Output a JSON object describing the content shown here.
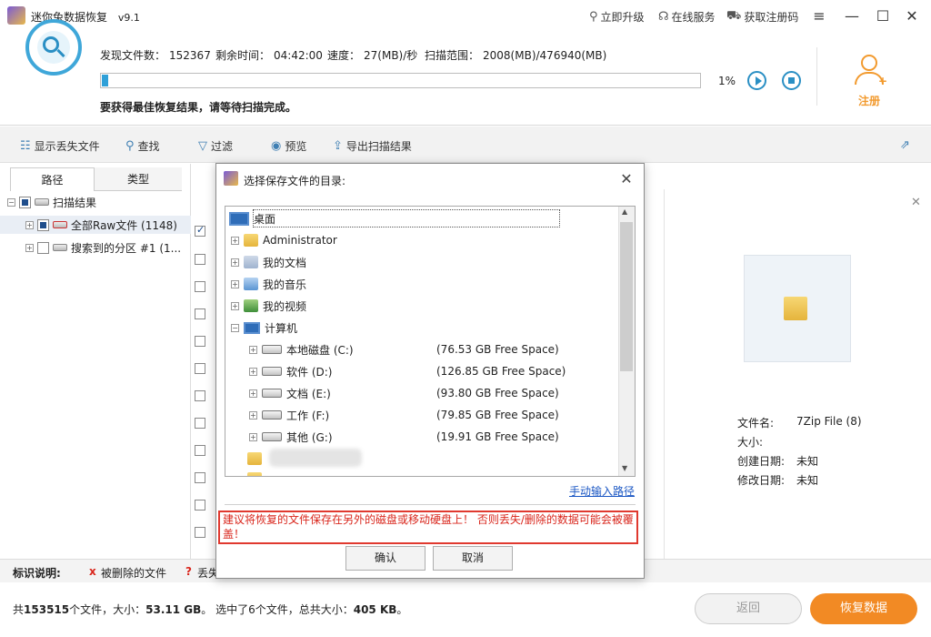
{
  "titlebar": {
    "app_title": "迷你兔数据恢复",
    "version": "v9.1",
    "links": [
      "立即升级",
      "在线服务",
      "获取注册码"
    ]
  },
  "scan": {
    "found_label": "发现文件数：",
    "found_value": "152367",
    "remaining_label": "剩余时间：",
    "remaining_value": "04:42:00",
    "speed_label": "速度：",
    "speed_value": "27(MB)/秒",
    "range_label": "扫描范围：",
    "range_value": "2008(MB)/476940(MB)",
    "progress_percent": "1%",
    "progress_fraction": 0.01,
    "hint": "要获得最佳恢复结果，请等待扫描完成。"
  },
  "register_label": "注册",
  "toolbar": {
    "show_lost": "显示丢失文件",
    "find": "查找",
    "filter": "过滤",
    "preview": "预览",
    "export": "导出扫描结果"
  },
  "left_panel": {
    "tab_path": "路径",
    "tab_type": "类型",
    "tree": [
      "扫描结果",
      "全部Raw文件 (1148)",
      "搜索到的分区 #1 (1..."
    ]
  },
  "preview": {
    "filename_label": "文件名:",
    "filename_value": "7Zip File (8)",
    "size_label": "大小:",
    "size_value": "",
    "created_label": "创建日期:",
    "created_value": "未知",
    "modified_label": "修改日期:",
    "modified_value": "未知"
  },
  "legend": {
    "title": "标识说明:",
    "deleted_mark": "x",
    "deleted": "被删除的文件",
    "lost_mark": "?",
    "lost": "丢失"
  },
  "summary": {
    "prefix": "共",
    "count": "153515",
    "mid": "个文件，大小：",
    "size": "53.11 GB",
    "selected": "。 选中了6个文件，总共大小：",
    "sel_size": "405 KB",
    "suffix": "。"
  },
  "buttons": {
    "back": "返回",
    "recover": "恢复数据"
  },
  "dialog": {
    "title": "选择保存文件的目录:",
    "tree": {
      "desktop": "桌面",
      "administrator": "Administrator",
      "my_documents": "我的文档",
      "my_music": "我的音乐",
      "my_videos": "我的视频",
      "computer": "计算机",
      "drives": [
        {
          "name": "本地磁盘 (C:)",
          "space": "(76.53 GB Free Space)"
        },
        {
          "name": "软件 (D:)",
          "space": "(126.85 GB Free Space)"
        },
        {
          "name": "文档 (E:)",
          "space": "(93.80 GB Free Space)"
        },
        {
          "name": "工作 (F:)",
          "space": "(79.85 GB Free Space)"
        },
        {
          "name": "其他 (G:)",
          "space": "(19.91 GB Free Space)"
        }
      ]
    },
    "manual_link": "手动输入路径",
    "warning": "建议将恢复的文件保存在另外的磁盘或移动硬盘上！ 否则丢失/删除的数据可能会被覆盖！",
    "confirm": "确认",
    "cancel": "取消"
  }
}
